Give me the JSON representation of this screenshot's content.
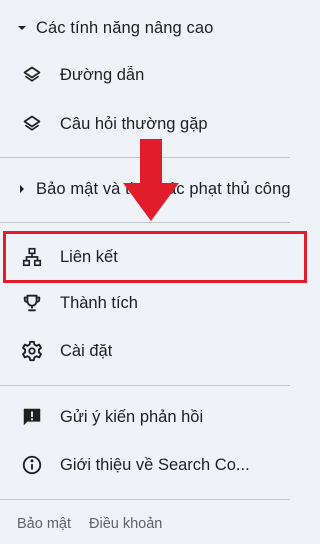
{
  "sections": {
    "advanced": {
      "label": "Các tính năng nâng cao",
      "expanded": true,
      "items": [
        {
          "label": "Đường dẫn",
          "icon": "layers-icon"
        },
        {
          "label": "Câu hỏi thường gặp",
          "icon": "layers-icon"
        }
      ]
    },
    "security": {
      "label": "Bảo mật và thao tác phạt thủ công",
      "expanded": false
    }
  },
  "nav": {
    "links": {
      "label": "Liên kết",
      "icon": "sitemap-icon"
    },
    "achievements": {
      "label": "Thành tích",
      "icon": "trophy-icon"
    },
    "settings": {
      "label": "Cài đặt",
      "icon": "gear-icon"
    },
    "feedback": {
      "label": "Gửi ý kiến phản hồi",
      "icon": "feedback-icon"
    },
    "about": {
      "label": "Giới thiệu về Search Co...",
      "icon": "info-icon"
    }
  },
  "footer": {
    "privacy": "Bảo mật",
    "terms": "Điều khoản"
  },
  "colors": {
    "background": "#eff2f7",
    "highlight": "#e11d2b",
    "text": "#1f1f1f",
    "footer_text": "#5f6368"
  }
}
